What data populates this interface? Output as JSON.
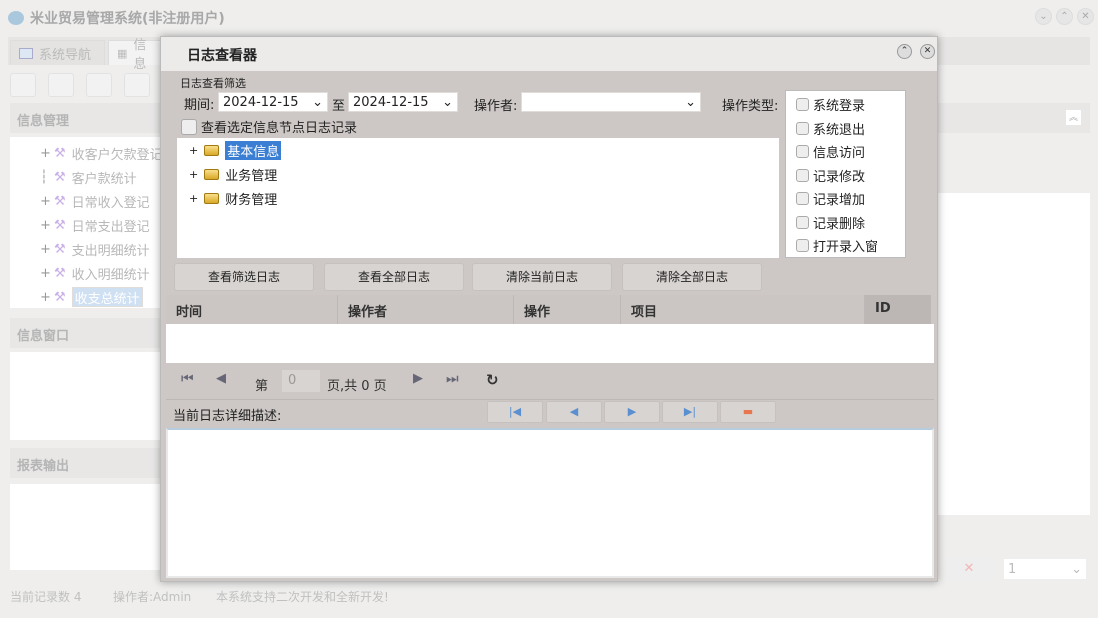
{
  "app": {
    "title": "米业贸易管理系统(非注册用户)"
  },
  "tabs": [
    {
      "label": "系统导航"
    },
    {
      "label": "信息"
    }
  ],
  "left": {
    "info_mgmt": "信息管理",
    "tree": [
      "收客户欠款登记",
      "客户款统计",
      "日常收入登记",
      "日常支出登记",
      "支出明细统计",
      "收入明细统计",
      "收支总统计"
    ],
    "selected_index": 6,
    "info_window": "信息窗口",
    "report_output": "报表输出"
  },
  "status": {
    "records": "当前记录数 4",
    "operator": "操作者:Admin",
    "notice": "本系统支持二次开发和全新开发!"
  },
  "bottom_right": {
    "page_select": "1"
  },
  "dialog": {
    "title": "日志查看器",
    "filter_group": "日志查看筛选",
    "period_label": "期间:",
    "date_from": "2024-12-15",
    "to_label": "至",
    "date_to": "2024-12-15",
    "operator_label": "操作者:",
    "operator_value": "",
    "optype_label": "操作类型:",
    "optypes": [
      "系统登录",
      "系统退出",
      "信息访问",
      "记录修改",
      "记录增加",
      "记录删除",
      "打开录入窗"
    ],
    "node_check": "查看选定信息节点日志记录",
    "tree": [
      "基本信息",
      "业务管理",
      "财务管理"
    ],
    "buttons": [
      "查看筛选日志",
      "查看全部日志",
      "清除当前日志",
      "清除全部日志"
    ],
    "columns": [
      "时间",
      "操作者",
      "操作",
      "项目",
      "ID"
    ],
    "pager": {
      "page_prefix": "第",
      "page": "0",
      "page_suffix": "页,共 0 页"
    },
    "detail_label": "当前日志详细描述:"
  }
}
